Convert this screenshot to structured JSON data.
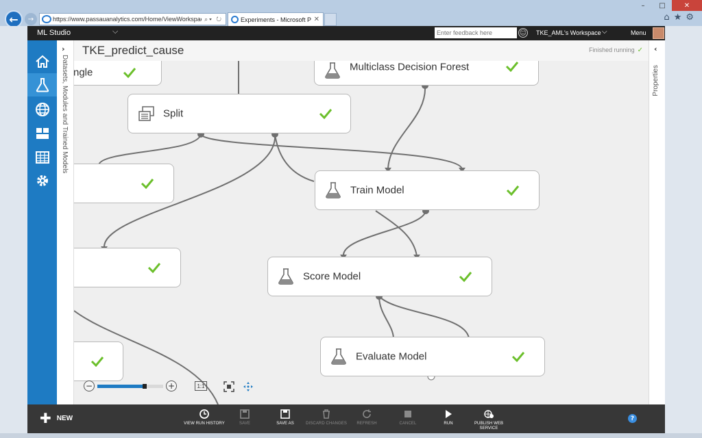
{
  "browser": {
    "url": "https://www.passauanalytics.com/Home/ViewWorkspace/",
    "tab_title": "Experiments - Microsoft Pa...",
    "window_minimize": "–",
    "window_maximize": "□",
    "window_close": "✕"
  },
  "header": {
    "app_name": "ML Studio",
    "feedback_placeholder": "Enter feedback here",
    "workspace": "TKE_AML's Workspace",
    "menu": "Menu"
  },
  "palette": {
    "label": "Datasets, Modules and Trained Models"
  },
  "canvas": {
    "experiment_title": "TKE_predict_cause",
    "status": "Finished running",
    "modules": [
      {
        "id": "partial-top",
        "label": "ngle",
        "status": "finished"
      },
      {
        "id": "split",
        "label": "Split",
        "icon": "split-icon",
        "status": "finished"
      },
      {
        "id": "multiclass-decision-forest",
        "label": "Multiclass Decision Forest",
        "icon": "flask-icon",
        "status": "finished"
      },
      {
        "id": "partial-left-1",
        "label": "",
        "status": "finished"
      },
      {
        "id": "train-model",
        "label": "Train Model",
        "icon": "flask-icon",
        "status": "finished"
      },
      {
        "id": "partial-left-2",
        "label": "",
        "status": "finished"
      },
      {
        "id": "score-model",
        "label": "Score Model",
        "icon": "flask-icon",
        "status": "finished"
      },
      {
        "id": "partial-left-3",
        "label": "",
        "status": "finished"
      },
      {
        "id": "evaluate-model",
        "label": "Evaluate Model",
        "icon": "flask-icon",
        "status": "finished"
      }
    ]
  },
  "zoom": {
    "minus": "−",
    "plus": "+",
    "actual_size": "1:1",
    "level_fraction": 0.72
  },
  "properties": {
    "label": "Properties"
  },
  "toolbar": {
    "new": "NEW",
    "buttons": [
      {
        "id": "view-run-history",
        "label": "VIEW RUN HISTORY",
        "enabled": true
      },
      {
        "id": "save",
        "label": "SAVE",
        "enabled": false
      },
      {
        "id": "save-as",
        "label": "SAVE AS",
        "enabled": true
      },
      {
        "id": "discard-changes",
        "label": "DISCARD CHANGES",
        "enabled": false
      },
      {
        "id": "refresh",
        "label": "REFRESH",
        "enabled": false
      },
      {
        "id": "cancel",
        "label": "CANCEL",
        "enabled": false
      },
      {
        "id": "run",
        "label": "RUN",
        "enabled": true
      },
      {
        "id": "publish-web-service",
        "label": "PUBLISH WEB SERVICE",
        "enabled": true
      }
    ],
    "help": "?"
  },
  "colors": {
    "accent": "#1e7bc3",
    "check": "#6bbf2b",
    "toolbar": "#373737",
    "header": "#222222"
  }
}
